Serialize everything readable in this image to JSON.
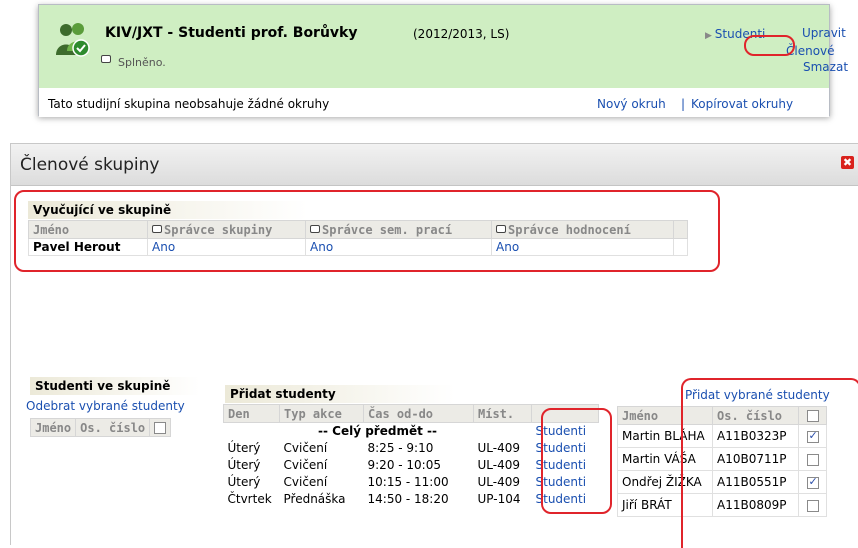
{
  "group": {
    "title": "KIV/JXT - Studenti prof. Borůvky",
    "period": "(2012/2013, LS)",
    "status": "Splněno.",
    "links": {
      "studenti": "Studenti",
      "upravit": "Upravit",
      "clenove": "Členové",
      "smazat": "Smazat"
    },
    "no_topics": "Tato studijní skupina neobsahuje žádné okruhy",
    "new_topic": "Nový okruh",
    "separator": "|",
    "copy_topics": "Kopírovat okruhy"
  },
  "dialog": {
    "title": "Členové skupiny",
    "close_glyph": "✖",
    "teachers": {
      "label": "Vyučující ve skupině",
      "headers": [
        "Jméno",
        "Správce skupiny",
        "Správce sem. prací",
        "Správce hodnocení"
      ],
      "rows": [
        {
          "name": "Pavel Herout",
          "admin": "Ano",
          "sem": "Ano",
          "eval": "Ano"
        }
      ]
    },
    "students_in_group": {
      "label": "Studenti ve skupině",
      "remove_link": "Odebrat vybrané studenty",
      "headers": [
        "Jméno",
        "Os. číslo"
      ]
    },
    "add_students": {
      "label": "Přidat studenty",
      "headers": [
        "Den",
        "Typ akce",
        "Čas od-do",
        "Míst."
      ],
      "whole_subject": "-- Celý předmět --",
      "link_label": "Studenti",
      "rows": [
        {
          "day": "Úterý",
          "type": "Cvičení",
          "time": "8:25 - 9:10",
          "room": "UL-409"
        },
        {
          "day": "Úterý",
          "type": "Cvičení",
          "time": "9:20 - 10:05",
          "room": "UL-409"
        },
        {
          "day": "Úterý",
          "type": "Cvičení",
          "time": "10:15 - 11:00",
          "room": "UL-409"
        },
        {
          "day": "Čtvrtek",
          "type": "Přednáška",
          "time": "14:50 - 18:20",
          "room": "UP-104"
        }
      ]
    },
    "candidates": {
      "add_link": "Přidat vybrané studenty",
      "headers": [
        "Jméno",
        "Os. číslo"
      ],
      "rows": [
        {
          "name": "Martin BLÁHA",
          "id": "A11B0323P",
          "checked": true
        },
        {
          "name": "Martin VÁŠA",
          "id": "A10B0711P",
          "checked": false
        },
        {
          "name": "Ondřej ŽIŽKA",
          "id": "A11B0551P",
          "checked": true
        },
        {
          "name": "Jiří BRÁT",
          "id": "A11B0809P",
          "checked": false
        }
      ]
    }
  },
  "colors": {
    "link": "#1a4fb0",
    "highlight": "#e0242b",
    "card_green": "#cfeec2"
  }
}
